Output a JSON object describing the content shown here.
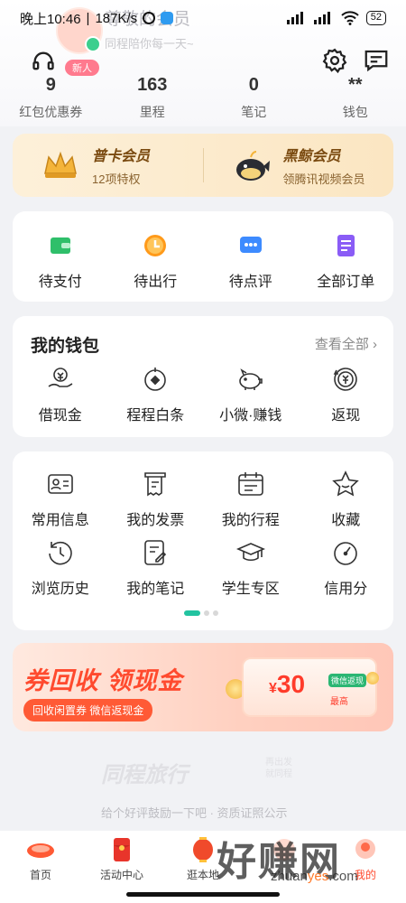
{
  "status_bar": {
    "time": "晚上10:46",
    "speed": "187K/s",
    "battery": "52"
  },
  "header": {
    "user_name": "尊敬的会员",
    "user_sub": "同程陪你每一天~",
    "level_tag": "新人"
  },
  "stats": [
    {
      "value": "9",
      "label": "红包优惠券"
    },
    {
      "value": "163",
      "label": "里程"
    },
    {
      "value": "0",
      "label": "笔记"
    },
    {
      "value": "**",
      "label": "钱包"
    }
  ],
  "membership": [
    {
      "title": "普卡会员",
      "sub": "12项特权"
    },
    {
      "title": "黑鲸会员",
      "sub": "领腾讯视频会员"
    }
  ],
  "orders": [
    {
      "label": "待支付",
      "icon": "wallet-icon",
      "color": "#2fbf6a"
    },
    {
      "label": "待出行",
      "icon": "clock-coin-icon",
      "color": "#ff9a1a"
    },
    {
      "label": "待点评",
      "icon": "comment-icon",
      "color": "#3d8bff"
    },
    {
      "label": "全部订单",
      "icon": "order-list-icon",
      "color": "#8a5cf6"
    }
  ],
  "wallet": {
    "title": "我的钱包",
    "more": "查看全部",
    "items": [
      {
        "label": "借现金",
        "icon": "cash-hand-icon"
      },
      {
        "label": "程程白条",
        "icon": "credit-line-icon"
      },
      {
        "label": "小微·赚钱",
        "icon": "piggy-bank-icon"
      },
      {
        "label": "返现",
        "icon": "cashback-icon"
      }
    ]
  },
  "tools": {
    "row1": [
      {
        "label": "常用信息",
        "icon": "id-card-icon"
      },
      {
        "label": "我的发票",
        "icon": "invoice-icon"
      },
      {
        "label": "我的行程",
        "icon": "calendar-icon"
      },
      {
        "label": "收藏",
        "icon": "star-icon"
      }
    ],
    "row2": [
      {
        "label": "浏览历史",
        "icon": "history-icon"
      },
      {
        "label": "我的笔记",
        "icon": "note-icon"
      },
      {
        "label": "学生专区",
        "icon": "graduation-cap-icon"
      },
      {
        "label": "信用分",
        "icon": "gauge-icon"
      }
    ]
  },
  "banner": {
    "title": "券回收 领现金",
    "sub": "回收闲置券 微信返现金",
    "amount": "30",
    "currency": "¥",
    "tag": "微信返现",
    "max": "最高"
  },
  "footer": {
    "logo": "同程旅行",
    "logo_sub": "再出发 就同程",
    "links": "给个好评鼓励一下吧 · 资质证照公示"
  },
  "tabbar": [
    {
      "label": "首页",
      "icon": "home-icon"
    },
    {
      "label": "活动中心",
      "icon": "red-envelope-icon"
    },
    {
      "label": "逛本地",
      "icon": "lantern-icon"
    },
    {
      "label": "",
      "icon": "center-icon"
    },
    {
      "label": "我的",
      "icon": "profile-icon"
    }
  ],
  "watermark": {
    "main": "好赚网",
    "sub_a": "zhuan",
    "sub_b": "yes",
    "sub_c": ".com"
  },
  "colors": {
    "accent": "#22c3a0",
    "orange": "#ff4a2e",
    "gold": "#7a4a10"
  }
}
